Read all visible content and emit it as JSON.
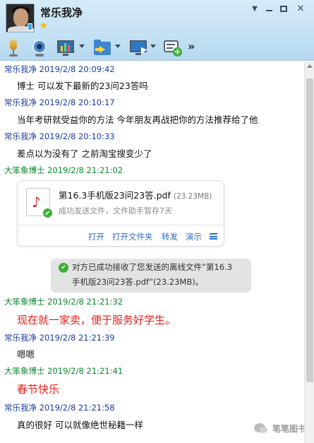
{
  "window": {
    "contact_name": "常乐我净",
    "icons": [
      "arrow-down-icon",
      "minimize-icon",
      "maximize-icon",
      "close-icon"
    ],
    "star_icon": "★"
  },
  "toolbar": {
    "items": [
      "microphone-icon",
      "camera-icon",
      "screen-share-icon",
      "folder-send-icon",
      "remote-desktop-icon",
      "add-message-icon"
    ],
    "more": "»"
  },
  "messages": [
    {
      "sender": "常乐我净",
      "time": "2019/2/8 20:09:42",
      "text": "博士 可以发下最新的23问23答吗"
    },
    {
      "sender": "常乐我净",
      "time": "2019/2/8 20:10:17",
      "text": "当年考研就受益你的方法 今年朋友再战把你的方法推荐给了他"
    },
    {
      "sender": "常乐我净",
      "time": "2019/2/8 20:10:33",
      "text": "差点以为没有了 之前淘宝搜变少了"
    },
    {
      "sender": "大笨象博士",
      "time": "2019/2/8 21:21:02"
    },
    {
      "sender": "大笨象博士",
      "time": "2019/2/8 21:21:32",
      "text": "现在就一家卖，便于服务好学生。"
    },
    {
      "sender": "常乐我净",
      "time": "2019/2/8 21:21:39",
      "text": "嗯嗯"
    },
    {
      "sender": "大笨象博士",
      "time": "2019/2/8 21:21:41",
      "text": "春节快乐"
    },
    {
      "sender": "常乐我净",
      "time": "2019/2/8 21:21:58",
      "text": "真的很好 可以就像绝世秘籍一样"
    }
  ],
  "file_card": {
    "file_name": "第16.3手机版23问23答.pdf",
    "file_size": "(23.23MB)",
    "status": "成功发送文件，文件助手暂存7天",
    "actions": [
      "打开",
      "打开文件夹",
      "转发",
      "演示"
    ]
  },
  "notice": {
    "line1": "对方已成功接收了您发送的离线文件“第16.3",
    "line2": "手机版23问23答.pdf”(23.23MB)。"
  },
  "watermark": {
    "text": "笔笔图书"
  },
  "colors": {
    "me_name": "#1a3a9e",
    "peer_name": "#0a8a2e",
    "highlight_text": "#e6201c",
    "link": "#2f6fc3"
  }
}
